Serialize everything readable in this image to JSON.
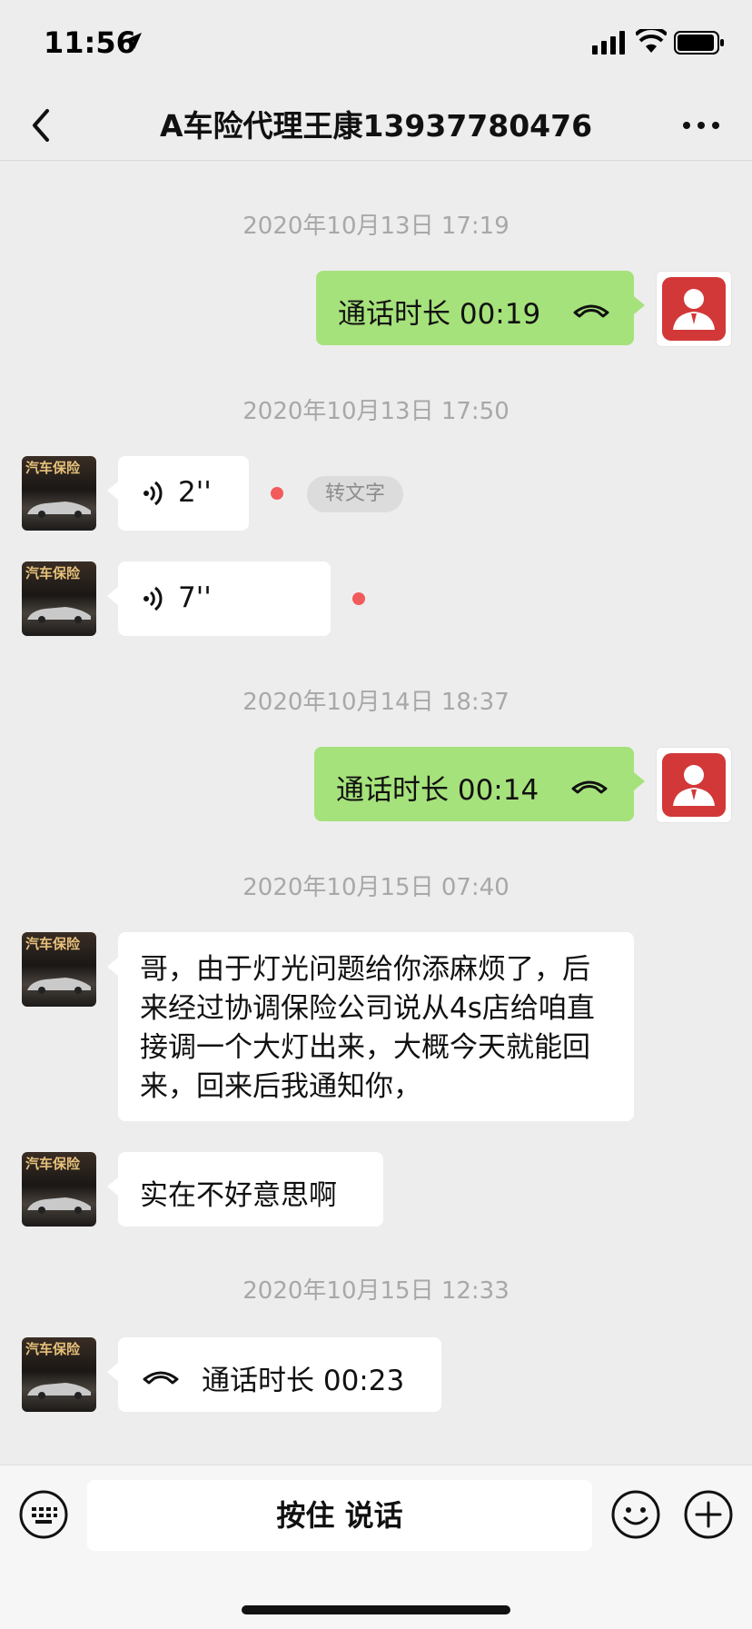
{
  "status_bar": {
    "time": "11:56"
  },
  "header": {
    "title": "A车险代理王康13937780476"
  },
  "messages": {
    "ts1": "2020年10月13日 17:19",
    "call1": "通话时长 00:19",
    "ts2": "2020年10月13日 17:50",
    "voice1": "2''",
    "to_text": "转文字",
    "voice2": "7''",
    "ts3": "2020年10月14日 18:37",
    "call2": "通话时长 00:14",
    "ts4": "2020年10月15日 07:40",
    "text1": "哥，由于灯光问题给你添麻烦了，后来经过协调保险公司说从4s店给咱直接调一个大灯出来，大概今天就能回来，回来后我通知你，",
    "text2": "实在不好意思啊",
    "ts5": "2020年10月15日 12:33",
    "call3": "通话时长 00:23"
  },
  "avatar": {
    "brand_text": "汽车保险"
  },
  "bottom_bar": {
    "hold_to_talk": "按住 说话"
  },
  "colors": {
    "sent_bubble": "#a6e27b",
    "received_bubble": "#ffffff",
    "background": "#ededed",
    "unread_dot": "#f15b5b",
    "avatar_red": "#d23838"
  }
}
